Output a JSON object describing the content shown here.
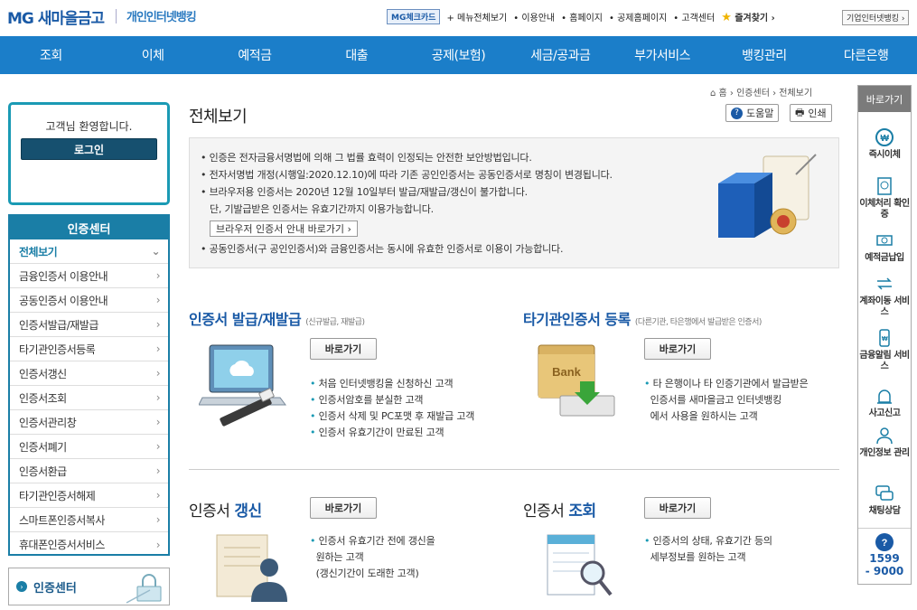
{
  "header": {
    "logo": "MG 새마을금고",
    "service": "개인인터넷뱅킹",
    "links": {
      "check_card": "MG체크카드",
      "menu_all": "메뉴전체보기",
      "guide": "이용안내",
      "home": "홈페이지",
      "mutual_home": "공제홈페이지",
      "customer_center": "고객센터",
      "favorites": "즐겨찾기"
    },
    "biz_banking": "기업인터넷뱅킹"
  },
  "gnb": [
    "조회",
    "이체",
    "예적금",
    "대출",
    "공제(보험)",
    "세금/공과금",
    "부가서비스",
    "뱅킹관리",
    "다른은행"
  ],
  "login": {
    "welcome": "고객님 환영합니다.",
    "button": "로그인"
  },
  "lnb": {
    "title": "인증센터",
    "items": [
      "전체보기",
      "금융인증서 이용안내",
      "공동인증서 이용안내",
      "인증서발급/재발급",
      "타기관인증서등록",
      "인증서갱신",
      "인증서조회",
      "인증서관리창",
      "인증서폐기",
      "인증서환급",
      "타기관인증서해제",
      "스마트폰인증서복사",
      "휴대폰인증서서비스"
    ]
  },
  "cert_center_button": "인증센터",
  "breadcrumb": {
    "home": "홈",
    "level1": "인증센터",
    "level2": "전체보기"
  },
  "page": {
    "title": "전체보기",
    "help": "도움말",
    "print": "인쇄"
  },
  "notice": {
    "lines": [
      "인증은 전자금융서명법에 의해 그 법률 효력이 인정되는 안전한 보안방법입니다.",
      "전자서명법 개정(시행일:2020.12.10)에 따라 기존 공인인증서는 공동인증서로 명칭이 변경됩니다.",
      "브라우저용 인증서는 2020년 12월 10일부터 발급/재발급/갱신이 불가합니다.",
      "단, 기발급받은 인증서는 유효기간까지 이용가능합니다."
    ],
    "browser_button": "브라우저 인증서 안내 바로가기",
    "last_line": "공동인증서(구 공인인증서)와 금융인증서는 동시에 유효한 인증서로 이용이 가능합니다."
  },
  "sections": {
    "issue": {
      "title": "인증서 발급/재발급",
      "sub": "(신규발급, 재발급)",
      "go": "바로가기",
      "bullets": [
        "처음 인터넷뱅킹을 신청하신 고객",
        "인증서암호를 분실한 고객",
        "인증서 삭제 및 PC포맷 후 재발급 고객",
        "인증서 유효기간이 만료된 고객"
      ]
    },
    "other": {
      "title": "타기관인증서 등록",
      "sub": "(다른기관, 타은행에서 발급받은 인증서)",
      "go": "바로가기",
      "bullets": [
        "타 은행이나 타 인증기관에서 발급받은",
        "인증서를 새마을금고 인터넷뱅킹",
        "에서 사용을 원하시는 고객"
      ],
      "image_label": "Bank"
    },
    "renew": {
      "title_a": "인증서",
      "title_b": "갱신",
      "go": "바로가기",
      "bullets": [
        "인증서 유효기간 전에 갱신을",
        "원하는 고객",
        "(갱신기간이 도래한 고객)"
      ]
    },
    "view": {
      "title_a": "인증서",
      "title_b": "조회",
      "go": "바로가기",
      "bullets": [
        "인증서의 상태, 유효기간 등의",
        "세부정보를 원하는 고객"
      ]
    }
  },
  "quick": {
    "title": "바로가기",
    "items": [
      "즉시이체",
      "이체처리 확인증",
      "예적금납입",
      "계좌이동 서비스",
      "금융알림 서비스",
      "사고신고",
      "개인정보 관리",
      "채팅상담"
    ],
    "tel_a": "1599",
    "tel_b": "- 9000"
  },
  "colors": {
    "brand": "#1b7ec9",
    "accent": "#1a9ab4",
    "dark": "#16506f"
  }
}
